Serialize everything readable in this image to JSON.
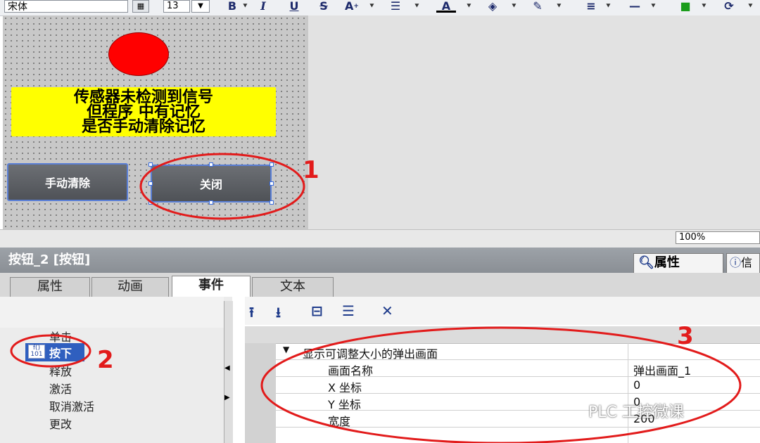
{
  "toolbar": {
    "font_name": "宋体",
    "font_size": "13",
    "bold_label": "B",
    "italic_label": "I",
    "underline_label": "U",
    "strikethrough_label": "S",
    "font_color_label": "A"
  },
  "canvas": {
    "message_lines": [
      "传感器未检测到信号",
      "但程序 中有记忆",
      "是否手动清除记忆"
    ],
    "btn_clear_label": "手动清除",
    "btn_close_label": "关闭",
    "lamp_color": "#ff0000"
  },
  "zoom": "100%",
  "properties": {
    "title": "按钮_2 [按钮]",
    "right_tab_properties": "属性",
    "right_tab_info": "信",
    "tabs": [
      "属性",
      "动画",
      "事件",
      "文本"
    ],
    "active_tab": "事件"
  },
  "events": [
    "单击",
    "按下",
    "释放",
    "激活",
    "取消激活",
    "更改"
  ],
  "selected_event": "按下",
  "function_list": {
    "function_name": "显示可调整大小的弹出画面",
    "params": [
      {
        "name": "画面名称",
        "value": "弹出画面_1"
      },
      {
        "name": "X 坐标",
        "value": "0"
      },
      {
        "name": "Y 坐标",
        "value": "0"
      },
      {
        "name": "宽度",
        "value": "200"
      }
    ]
  },
  "annotations": [
    "1",
    "2",
    "3"
  ],
  "annotation_color": "#e21b1b",
  "watermark": "PLC 工控微课"
}
